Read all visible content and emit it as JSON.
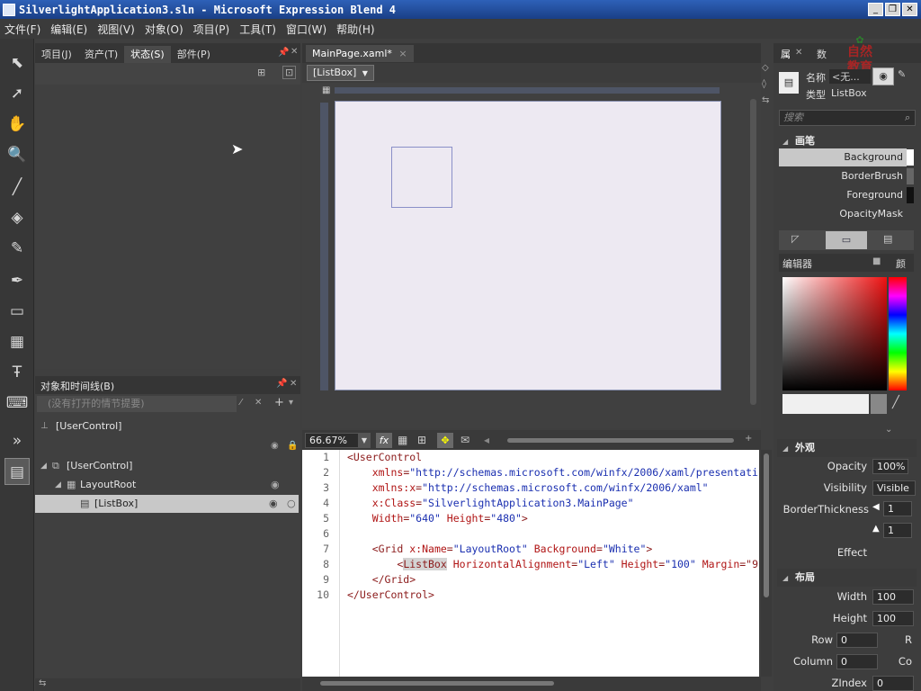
{
  "window": {
    "title": "SilverlightApplication3.sln - Microsoft Expression Blend 4",
    "minimize": "_",
    "restore": "❐",
    "close": "✕"
  },
  "menu": [
    "文件(F)",
    "编辑(E)",
    "视图(V)",
    "对象(O)",
    "项目(P)",
    "工具(T)",
    "窗口(W)",
    "帮助(H)"
  ],
  "left_tabs": {
    "tabs": [
      "项目(J)",
      "资产(T)",
      "状态(S)",
      "部件(P)"
    ],
    "active_index": 2
  },
  "objects_panel": {
    "title": "对象和时间线(B)",
    "search_placeholder": "(没有打开的情节提要)",
    "scope": "[UserControl]",
    "tree": [
      {
        "label": "[UserControl]",
        "level": 0
      },
      {
        "label": "LayoutRoot",
        "level": 1
      },
      {
        "label": "[ListBox]",
        "level": 2,
        "selected": true
      }
    ]
  },
  "document": {
    "tab": "MainPage.xaml*",
    "breadcrumb": "[ListBox]"
  },
  "zoom": "66.67%",
  "code_lines": [
    {
      "n": "1",
      "parts": [
        [
          "tag",
          "<UserControl"
        ]
      ]
    },
    {
      "n": "2",
      "parts": [
        [
          "attr",
          "    xmlns"
        ],
        [
          "tag",
          "="
        ],
        [
          "val",
          "\"http://schemas.microsoft.com/winfx/2006/xaml/presentati"
        ]
      ]
    },
    {
      "n": "3",
      "parts": [
        [
          "attr",
          "    xmlns:x"
        ],
        [
          "tag",
          "="
        ],
        [
          "val",
          "\"http://schemas.microsoft.com/winfx/2006/xaml\""
        ]
      ]
    },
    {
      "n": "4",
      "parts": [
        [
          "attr",
          "    x:Class"
        ],
        [
          "tag",
          "="
        ],
        [
          "val",
          "\"SilverlightApplication3.MainPage\""
        ]
      ]
    },
    {
      "n": "5",
      "parts": [
        [
          "attr",
          "    Width"
        ],
        [
          "tag",
          "="
        ],
        [
          "val",
          "\"640\" "
        ],
        [
          "attr",
          "Height"
        ],
        [
          "tag",
          "="
        ],
        [
          "val",
          "\"480\""
        ],
        [
          "tag",
          ">"
        ]
      ]
    },
    {
      "n": "6",
      "parts": []
    },
    {
      "n": "7",
      "parts": [
        [
          "tag",
          "    <Grid "
        ],
        [
          "attr",
          "x:Name"
        ],
        [
          "tag",
          "="
        ],
        [
          "val",
          "\"LayoutRoot\" "
        ],
        [
          "attr",
          "Background"
        ],
        [
          "tag",
          "="
        ],
        [
          "val",
          "\"White\""
        ],
        [
          "tag",
          ">"
        ]
      ]
    },
    {
      "n": "8",
      "parts": [
        [
          "tag",
          "        <"
        ],
        [
          "tag",
          "ListBox"
        ],
        [
          "attr",
          " HorizontalAlignment"
        ],
        [
          "tag",
          "="
        ],
        [
          "val",
          "\"Left\" "
        ],
        [
          "attr",
          "Height"
        ],
        [
          "tag",
          "="
        ],
        [
          "val",
          "\"100\" "
        ],
        [
          "attr",
          "Margin"
        ],
        [
          "tag",
          "=\"9"
        ]
      ]
    },
    {
      "n": "9",
      "parts": [
        [
          "tag",
          "    </Grid>"
        ]
      ]
    },
    {
      "n": "10",
      "parts": [
        [
          "tag",
          "</UserControl>"
        ]
      ]
    }
  ],
  "properties": {
    "tabs": [
      "属",
      "数"
    ],
    "name_label": "名称",
    "name_value": "<无...",
    "type_label": "类型",
    "type_value": "ListBox",
    "search_placeholder": "搜索",
    "brushes_title": "画笔",
    "brushes": [
      "Background",
      "BorderBrush",
      "Foreground",
      "OpacityMask"
    ],
    "editor_label": "编辑器",
    "editor_tab": "颜",
    "appearance_title": "外观",
    "opacity_label": "Opacity",
    "opacity_value": "100%",
    "visibility_label": "Visibility",
    "visibility_value": "Visible",
    "border_label": "BorderThickness",
    "border_top": "1",
    "border_left": "1",
    "effect_label": "Effect",
    "layout_title": "布局",
    "width_label": "Width",
    "width_value": "100",
    "height_label": "Height",
    "height_value": "100",
    "row_label": "Row",
    "row_value": "0",
    "rowspan_label": "R",
    "column_label": "Column",
    "column_value": "0",
    "colspan_label": "Co",
    "zindex_label": "ZIndex",
    "zindex_value": "0"
  },
  "watermark": {
    "line1": "自然",
    "line2": "教育"
  },
  "colors": {
    "accent": "#2e61b8",
    "canvas": "#ede9f2",
    "selection": "#c8c8c8"
  }
}
